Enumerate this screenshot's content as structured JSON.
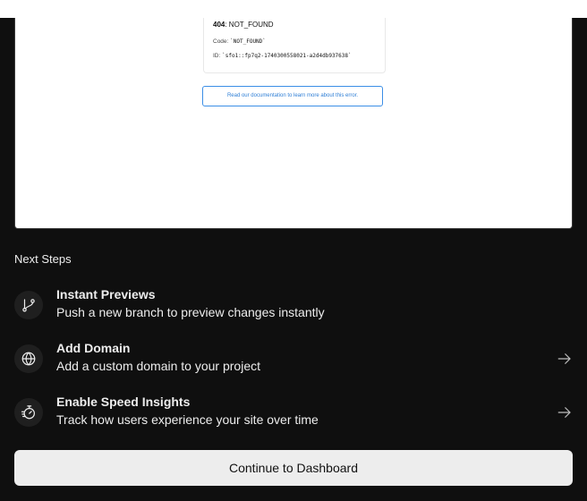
{
  "preview": {
    "error": {
      "status": "404",
      "message": ": NOT_FOUND",
      "code_label": "Code: ",
      "code_value": "`NOT_FOUND`",
      "id_label": "ID: ",
      "id_value": "`sfo1::fp7q2-1740300558021-a2d4db937638`"
    },
    "doc_link": "Read our documentation to learn more about this error."
  },
  "next_steps": {
    "heading": "Next Steps",
    "items": [
      {
        "title": "Instant Previews",
        "description": "Push a new branch to preview changes instantly",
        "icon": "git-branch-icon",
        "has_arrow": false
      },
      {
        "title": "Add Domain",
        "description": "Add a custom domain to your project",
        "icon": "globe-icon",
        "has_arrow": true
      },
      {
        "title": "Enable Speed Insights",
        "description": "Track how users experience your site over time",
        "icon": "stopwatch-icon",
        "has_arrow": true
      }
    ]
  },
  "continue_button": "Continue to Dashboard",
  "colors": {
    "background": "#0f0f0f",
    "text": "#ededed",
    "icon_bg": "#1f1f1f",
    "button_bg": "#ededed",
    "link_blue": "#2f7fd6"
  }
}
